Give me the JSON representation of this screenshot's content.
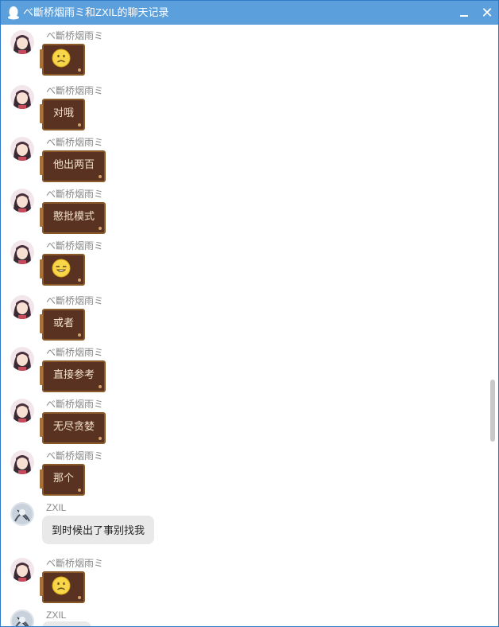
{
  "window": {
    "title": "ベ斷桥烟雨ミ和ZXIL的聊天记录",
    "accent_color": "#5ba0dc"
  },
  "contacts": {
    "a": "ベ斷桥烟雨ミ",
    "b": "ZXIL"
  },
  "messages": [
    {
      "sender": "ベ斷桥烟雨ミ",
      "type": "emoji",
      "emoji": "sad-face-icon"
    },
    {
      "sender": "ベ斷桥烟雨ミ",
      "type": "text",
      "text": "对哦"
    },
    {
      "sender": "ベ斷桥烟雨ミ",
      "type": "text",
      "text": "他出两百"
    },
    {
      "sender": "ベ斷桥烟雨ミ",
      "type": "text",
      "text": "憨批模式"
    },
    {
      "sender": "ベ斷桥烟雨ミ",
      "type": "emoji",
      "emoji": "squint-laugh-icon"
    },
    {
      "sender": "ベ斷桥烟雨ミ",
      "type": "text",
      "text": "或者"
    },
    {
      "sender": "ベ斷桥烟雨ミ",
      "type": "text",
      "text": "直接参考"
    },
    {
      "sender": "ベ斷桥烟雨ミ",
      "type": "text",
      "text": "无尽贪婪"
    },
    {
      "sender": "ベ斷桥烟雨ミ",
      "type": "text",
      "text": "那个"
    },
    {
      "sender": "ZXIL",
      "type": "text",
      "text": "到时候出了事别找我"
    },
    {
      "sender": "ベ斷桥烟雨ミ",
      "type": "emoji",
      "emoji": "sad-face-icon"
    },
    {
      "sender": "ZXIL",
      "type": "text",
      "text": ""
    }
  ]
}
